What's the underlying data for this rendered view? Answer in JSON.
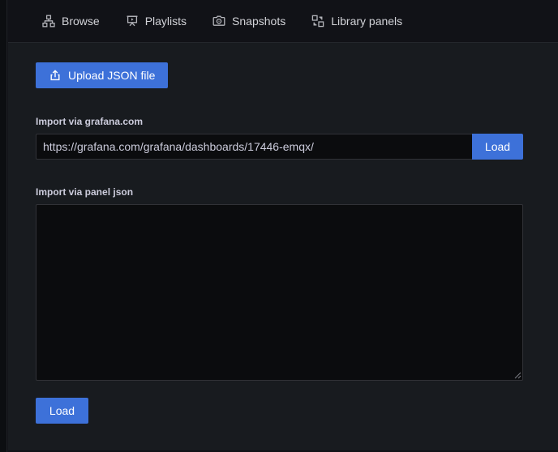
{
  "tabs": [
    {
      "label": "Browse",
      "icon": "sitemap-icon"
    },
    {
      "label": "Playlists",
      "icon": "presentation-play-icon"
    },
    {
      "label": "Snapshots",
      "icon": "camera-icon"
    },
    {
      "label": "Library panels",
      "icon": "library-panels-icon"
    }
  ],
  "import": {
    "upload_button_label": "Upload JSON file",
    "gcom_label": "Import via grafana.com",
    "gcom_url_value": "https://grafana.com/grafana/dashboards/17446-emqx/",
    "gcom_load_label": "Load",
    "panel_json_label": "Import via panel json",
    "panel_json_value": "",
    "panel_load_label": "Load"
  },
  "colors": {
    "primary_button": "#3d71d9",
    "panel_background": "#181b1f",
    "canvas_background": "#111217",
    "input_background": "#0b0c0e",
    "text_primary": "#ccccdc"
  }
}
